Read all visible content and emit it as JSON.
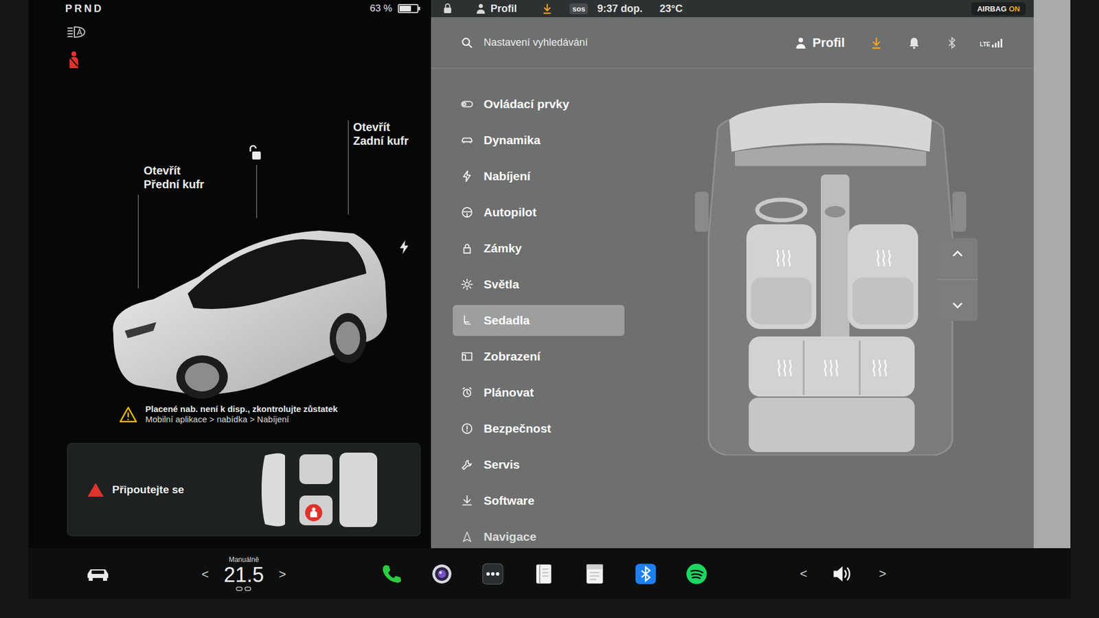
{
  "top_bar": {
    "gears": "PRND",
    "battery": "63 %",
    "profile": "Profil",
    "sos": "sos",
    "time": "9:37 dop.",
    "temperature": "23°C",
    "airbag": "AIRBAG",
    "airbag_state": "ON"
  },
  "car_view": {
    "frunk_action": "Otevřít",
    "frunk_label": "Přední kufr",
    "trunk_action": "Otevřít",
    "trunk_label": "Zadní kufr",
    "locked": false
  },
  "alert": {
    "line1": "Placené nab. není k disp., zkontrolujte zůstatek",
    "line2": "Mobilní aplikace > nabídka > Nabíjení"
  },
  "seatbelt_card": {
    "message": "Připoutejte se"
  },
  "settings": {
    "search_placeholder": "Nastavení vyhledávání",
    "profile": "Profil",
    "network": "LTE",
    "menu": [
      {
        "label": "Ovládací prvky",
        "selected": false
      },
      {
        "label": "Dynamika",
        "selected": false
      },
      {
        "label": "Nabíjení",
        "selected": false
      },
      {
        "label": "Autopilot",
        "selected": false
      },
      {
        "label": "Zámky",
        "selected": false
      },
      {
        "label": "Světla",
        "selected": false
      },
      {
        "label": "Sedadla",
        "selected": true
      },
      {
        "label": "Zobrazení",
        "selected": false
      },
      {
        "label": "Plánovat",
        "selected": false
      },
      {
        "label": "Bezpečnost",
        "selected": false
      },
      {
        "label": "Servis",
        "selected": false
      },
      {
        "label": "Software",
        "selected": false
      },
      {
        "label": "Navigace",
        "selected": false
      }
    ]
  },
  "bottom_bar": {
    "climate_mode": "Manuálně",
    "cabin_temp": "21.5",
    "temp_down": "<",
    "temp_up": ">",
    "volume_down": "<",
    "volume_up": ">"
  }
}
